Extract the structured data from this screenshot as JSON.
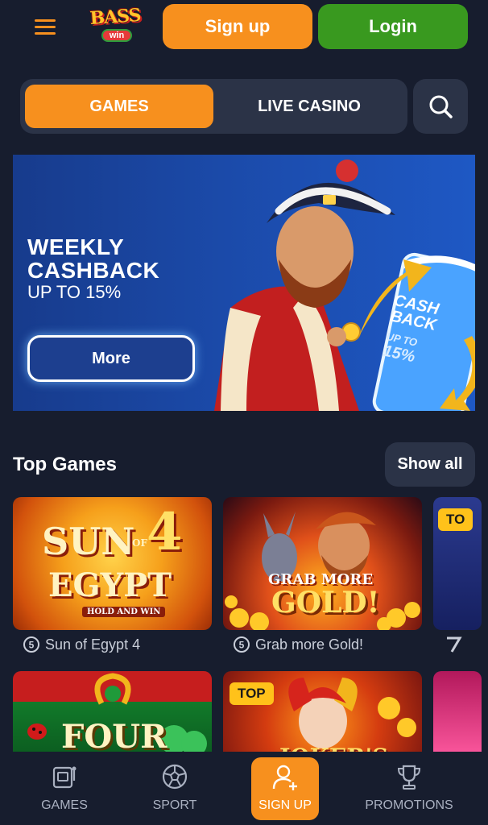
{
  "header": {
    "logo_text": "BASS",
    "logo_sub": "win",
    "signup_label": "Sign up",
    "login_label": "Login"
  },
  "tabs": [
    {
      "label": "GAMES",
      "active": true
    },
    {
      "label": "LIVE CASINO",
      "active": false
    }
  ],
  "banner": {
    "title_line1": "WEEKLY",
    "title_line2": "CASHBACK",
    "subtitle": "UP TO 15%",
    "button_label": "More",
    "phone_line1": "CASH",
    "phone_line2": "BACK",
    "phone_line3": "UP TO",
    "phone_line4": "15%"
  },
  "top_games": {
    "title": "Top Games",
    "show_all_label": "Show all",
    "row1": [
      {
        "name": "Sun of Egypt 4",
        "art_line1": "SUN",
        "art_of": "OF",
        "art_num": "4",
        "art_line2": "EGYPT",
        "art_tag": "HOLD AND WIN"
      },
      {
        "name": "Grab more Gold!",
        "art_line1": "GRAB MORE",
        "art_line2": "GOLD!"
      },
      {
        "name": "",
        "badge": "TO"
      }
    ],
    "row2": [
      {
        "art_line1": "FOUR"
      },
      {
        "badge": "TOP",
        "art_line1": "JOKER'S"
      },
      {}
    ]
  },
  "bottom_nav": [
    {
      "label": "GAMES",
      "icon": "slot-machine-icon"
    },
    {
      "label": "SPORT",
      "icon": "soccer-ball-icon"
    },
    {
      "label": "SIGN UP",
      "icon": "add-user-icon"
    },
    {
      "label": "PROMOTIONS",
      "icon": "trophy-icon"
    }
  ],
  "colors": {
    "background": "#171d2e",
    "accent_orange": "#f7901e",
    "login_green": "#39991f",
    "panel": "#2b3347",
    "banner_blue": "#1b4aa9"
  }
}
